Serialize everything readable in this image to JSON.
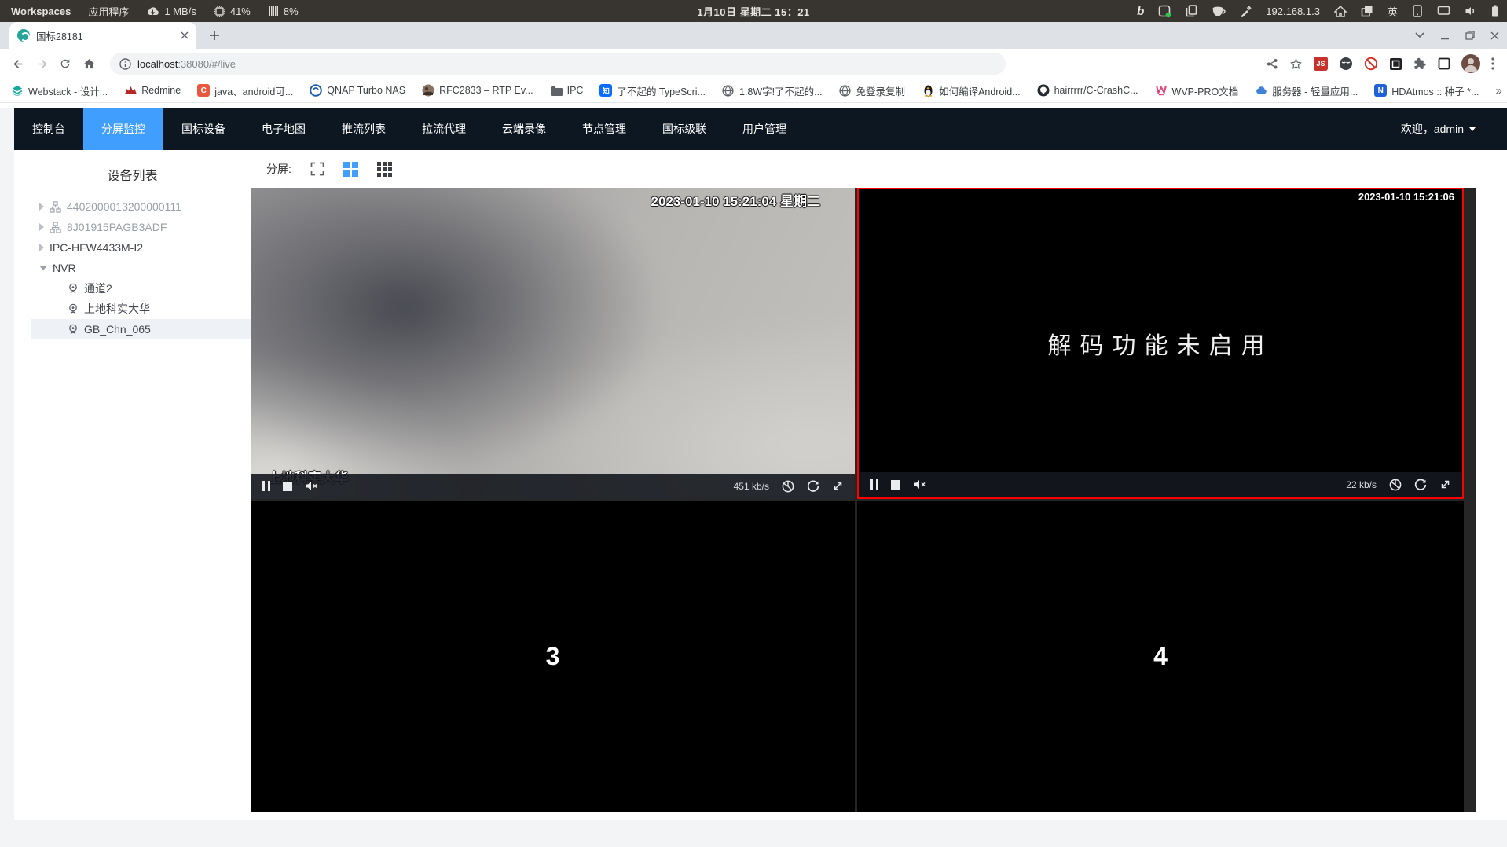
{
  "colors": {
    "accent": "#409EFF",
    "nav_bg": "#0C1722",
    "selected_cell_border": "#FF0000",
    "favicon_teal": "#26A69A"
  },
  "sysbar": {
    "workspaces": "Workspaces",
    "applications": "应用程序",
    "net_speed": "1 MB/s",
    "cpu": "41%",
    "mem": "8%",
    "datetime": "1月10日 星期二 15：21",
    "ip": "192.168.1.3",
    "lang": "英"
  },
  "browser": {
    "tab_title": "国标28181",
    "url_host": "localhost",
    "url_rest": ":38080/#/live",
    "bookmarks_overflow": "»",
    "bookmarks": [
      {
        "icon": "layers-icon",
        "label": "Webstack - 设计..."
      },
      {
        "icon": "redmine-icon",
        "label": "Redmine"
      },
      {
        "icon": "c-badge-icon",
        "label": "java、android可..."
      },
      {
        "icon": "qnap-icon",
        "label": "QNAP Turbo NAS"
      },
      {
        "icon": "photo-icon",
        "label": "RFC2833 – RTP Ev..."
      },
      {
        "icon": "folder-icon",
        "label": "IPC"
      },
      {
        "icon": "zhihu-icon",
        "label": "了不起的 TypeScri..."
      },
      {
        "icon": "globe-icon",
        "label": "1.8W字!了不起的..."
      },
      {
        "icon": "globe-icon",
        "label": "免登录复制"
      },
      {
        "icon": "penguin-icon",
        "label": "如何编译Android..."
      },
      {
        "icon": "github-icon",
        "label": "hairrrrr/C-CrashC..."
      },
      {
        "icon": "wvp-icon",
        "label": "WVP-PRO文档"
      },
      {
        "icon": "cloud-icon",
        "label": "服务器 - 轻量应用..."
      },
      {
        "icon": "n-badge-icon",
        "label": "HDAtmos :: 种子 *..."
      }
    ]
  },
  "nav": {
    "items": [
      {
        "label": "控制台",
        "active": false
      },
      {
        "label": "分屏监控",
        "active": true
      },
      {
        "label": "国标设备",
        "active": false
      },
      {
        "label": "电子地图",
        "active": false
      },
      {
        "label": "推流列表",
        "active": false
      },
      {
        "label": "拉流代理",
        "active": false
      },
      {
        "label": "云端录像",
        "active": false
      },
      {
        "label": "节点管理",
        "active": false
      },
      {
        "label": "国标级联",
        "active": false
      },
      {
        "label": "用户管理",
        "active": false
      }
    ],
    "welcome": "欢迎，admin"
  },
  "sidebar": {
    "title": "设备列表",
    "tree": [
      {
        "label": "4402000013200000111",
        "type": "platform",
        "muted": true
      },
      {
        "label": "8J01915PAGB3ADF",
        "type": "platform",
        "muted": true
      },
      {
        "label": "IPC-HFW4433M-I2",
        "type": "device",
        "muted": false
      },
      {
        "label": "NVR",
        "type": "device",
        "muted": false,
        "expanded": true,
        "children": [
          {
            "label": "通道2",
            "selected": false
          },
          {
            "label": "上地科实大华",
            "selected": false
          },
          {
            "label": "GB_Chn_065",
            "selected": true
          }
        ]
      }
    ]
  },
  "toolbar": {
    "split_label": "分屏:"
  },
  "players": {
    "cell1": {
      "timestamp": "2023-01-10 15:21:04 星期二",
      "osd_name": "上地科实大华",
      "bitrate": "451 kb/s"
    },
    "cell2": {
      "timestamp": "2023-01-10 15:21:06",
      "message": "解码功能未启用",
      "bitrate": "22 kb/s"
    },
    "cell3": {
      "number": "3"
    },
    "cell4": {
      "number": "4"
    }
  }
}
